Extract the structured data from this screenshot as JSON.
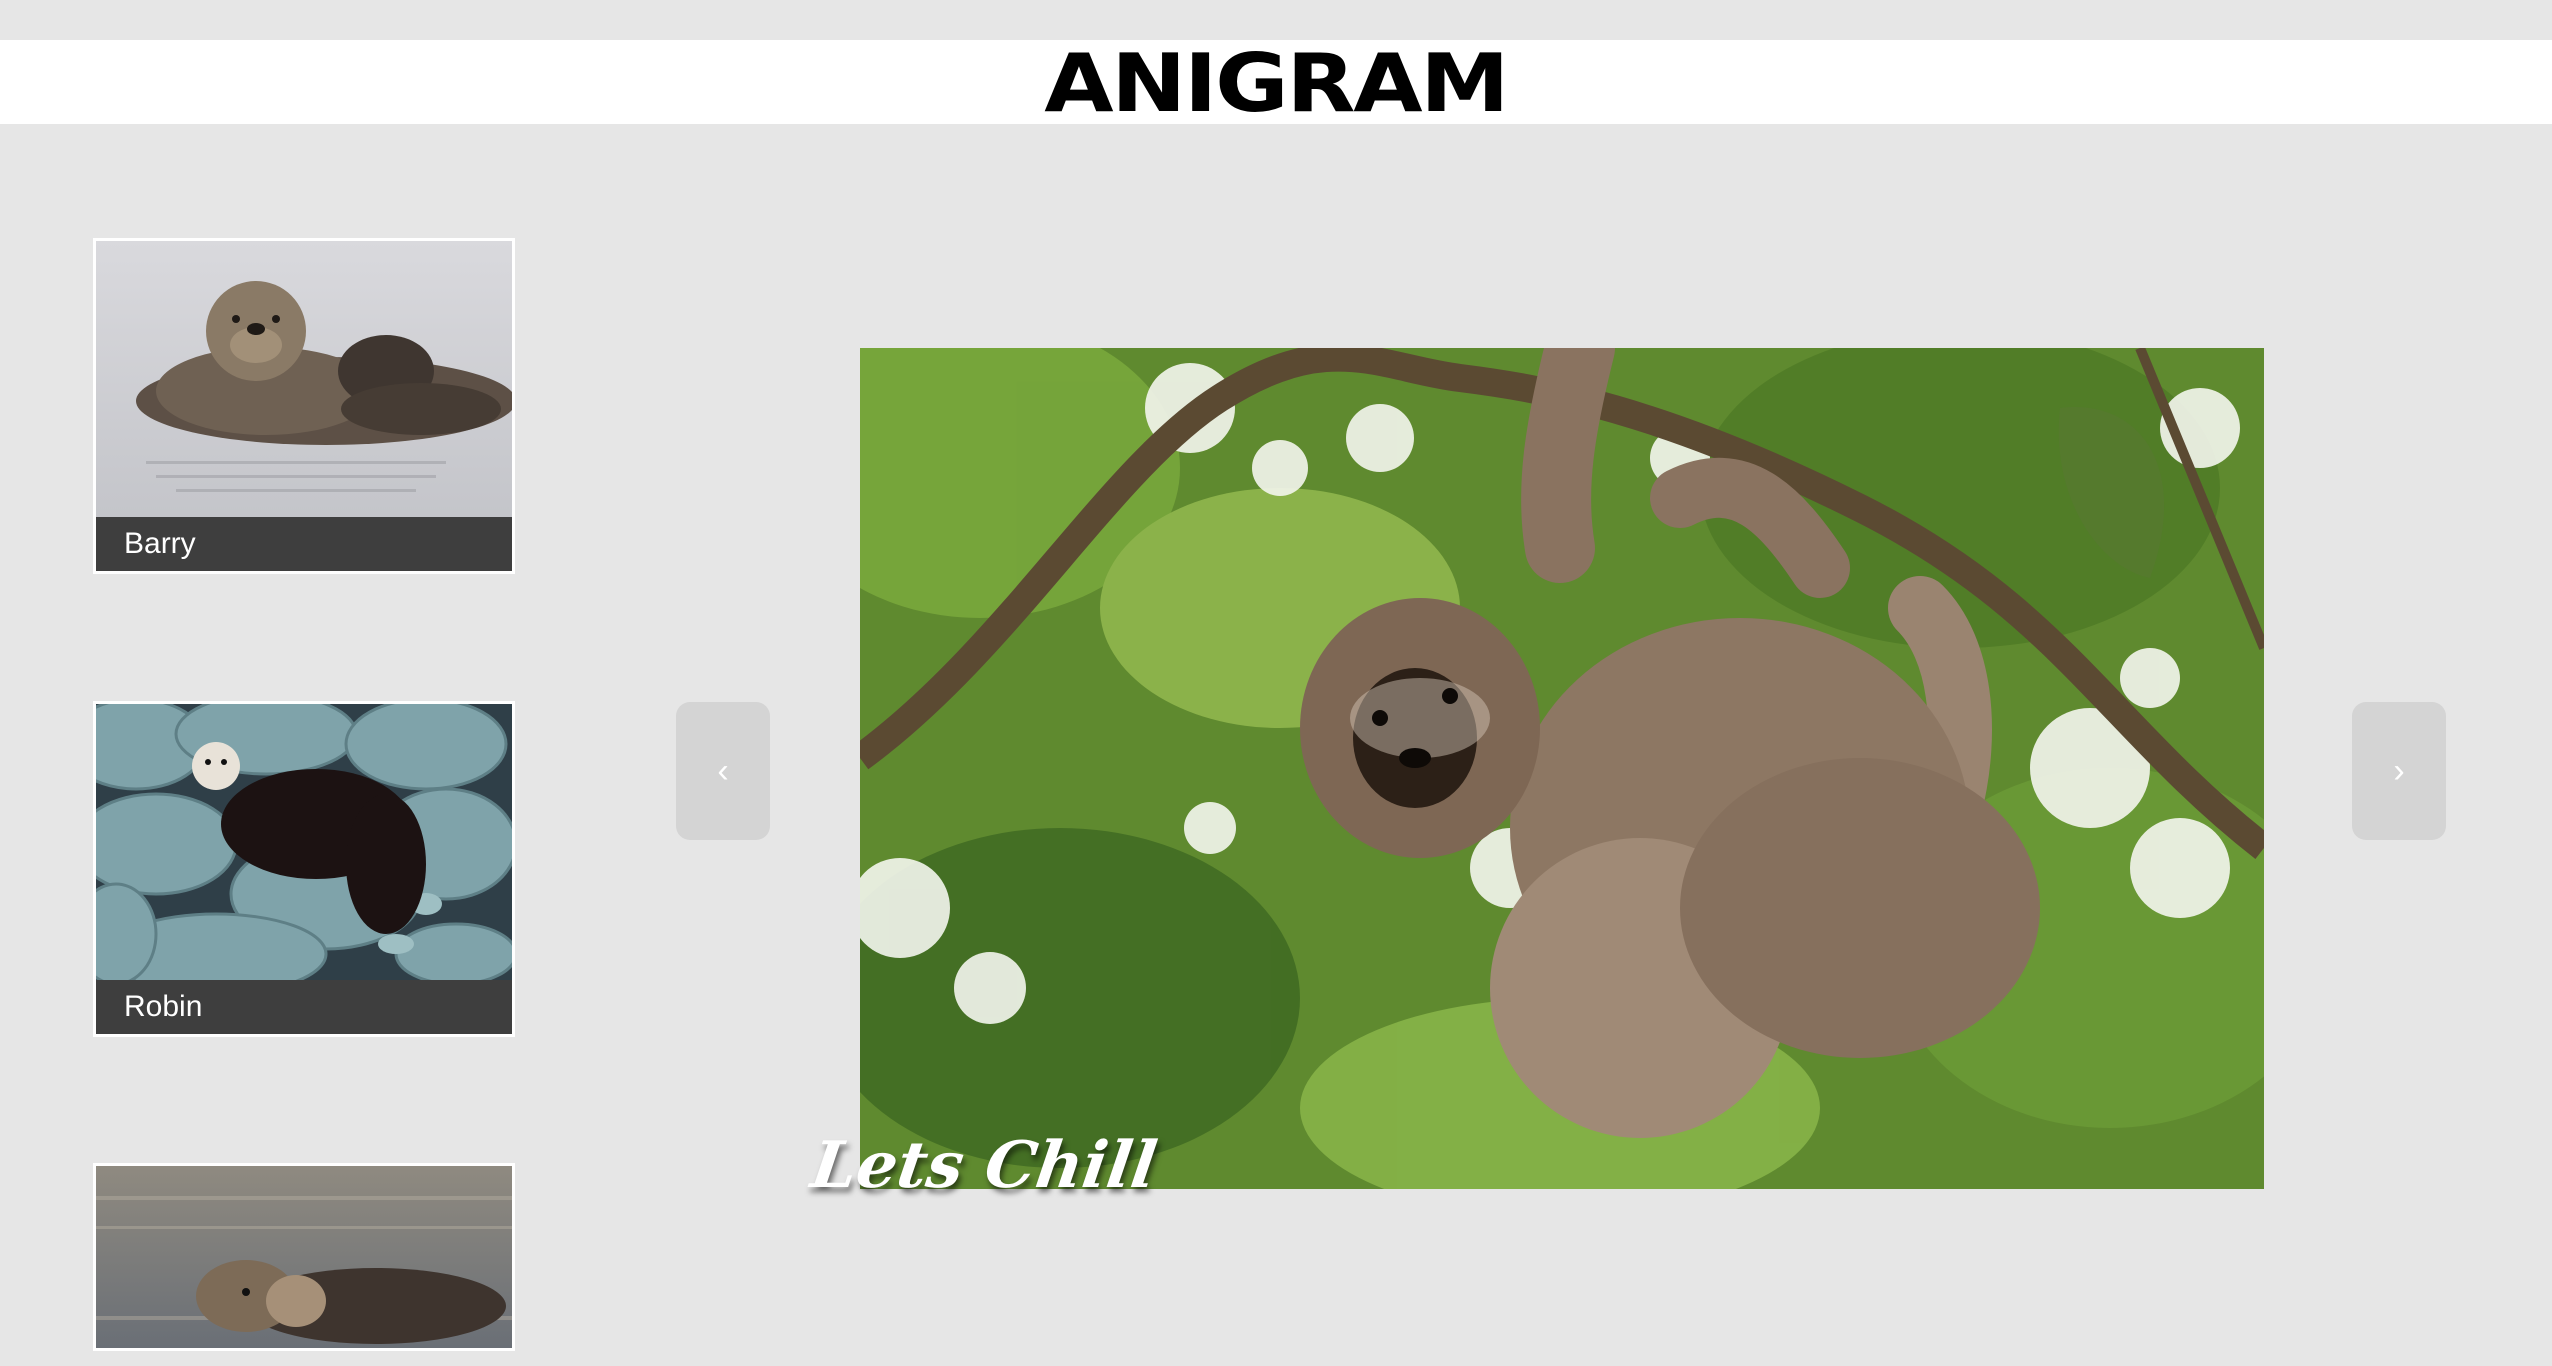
{
  "header": {
    "logo": "ANIGRAM"
  },
  "gallery": {
    "thumbnails": [
      {
        "name": "Barry",
        "image": "sea-otter-floating"
      },
      {
        "name": "Robin",
        "image": "sea-otter-on-rocks"
      },
      {
        "name": "",
        "image": "sea-otters-in-water"
      }
    ]
  },
  "viewer": {
    "image": "sloth-hanging-from-branch",
    "caption": "Lets Chill",
    "prev_icon": "chevron-left-icon",
    "prev_glyph": "‹",
    "next_icon": "chevron-right-icon",
    "next_glyph": "›"
  },
  "colors": {
    "page_bg": "#e6e6e6",
    "header_bg": "#ffffff",
    "caption_bar": "#3e3e3e",
    "nav_button": "#d4d4d4"
  }
}
